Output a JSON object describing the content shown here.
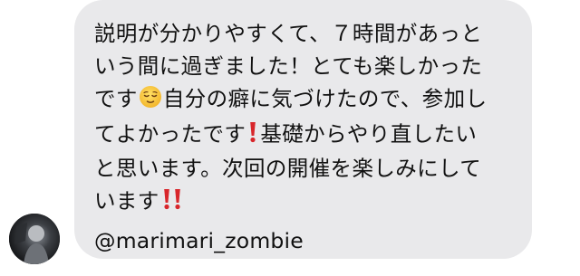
{
  "message": {
    "line1": "説明が分かりやすくて、７時間があっと",
    "line2": "いう間に過ぎました！とても楽しかった",
    "line3a": "です",
    "line3b": "自分の癖に気づけたので、参加し",
    "line4a": "てよかったです",
    "line4b": "基礎からやり直したい",
    "line5": "と思います。次回の開催を楽しみにして",
    "line6a": "います",
    "handle": "@marimari_zombie"
  },
  "icons": {
    "relieved_face": "relieved-face-icon",
    "exclamation": "red-exclamation-icon",
    "double_exclamation": "red-double-exclamation-icon"
  },
  "colors": {
    "bubble": "#e9e9eb",
    "text": "#111111",
    "exclamation": "#d8262b",
    "emoji_face": "#fbc935"
  }
}
